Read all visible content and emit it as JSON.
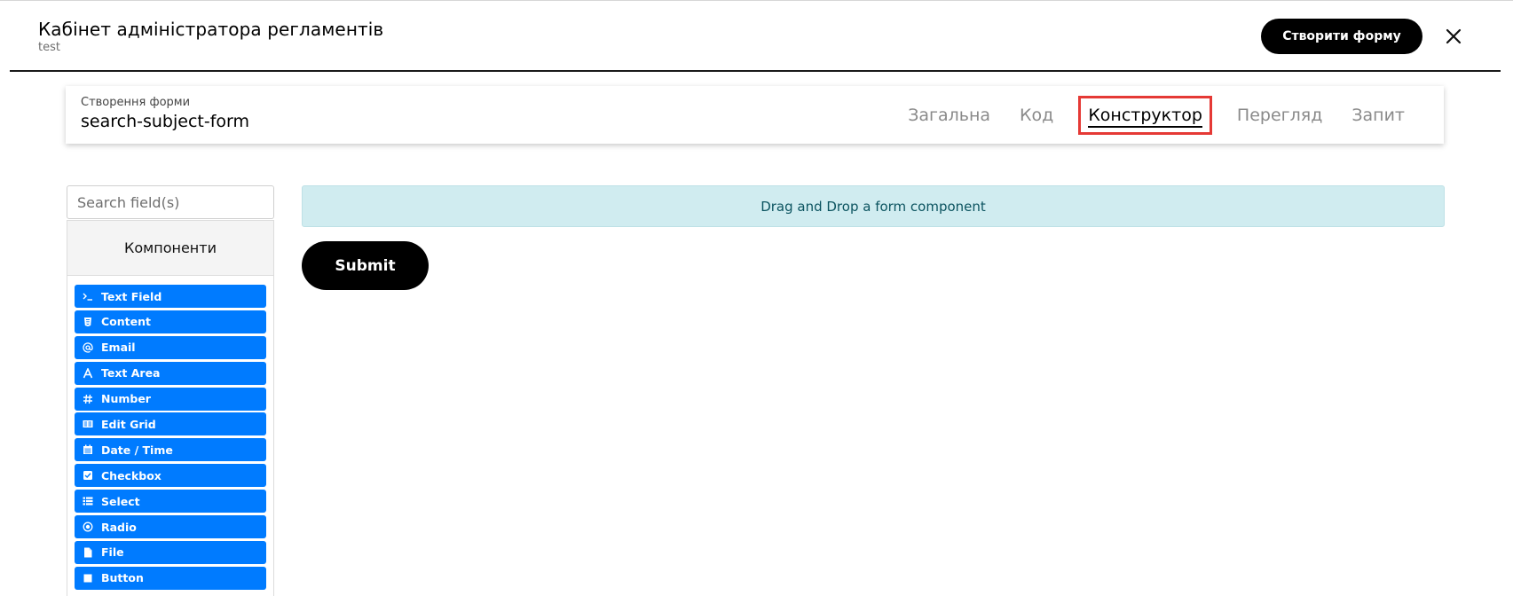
{
  "header": {
    "title": "Кабінет адміністратора регламентів",
    "subtitle": "test",
    "create_button_label": "Створити форму"
  },
  "form_card": {
    "caption": "Створення форми",
    "form_name": "search-subject-form",
    "tabs": [
      {
        "label": "Загальна",
        "active": false
      },
      {
        "label": "Код",
        "active": false
      },
      {
        "label": "Конструктор",
        "active": true
      },
      {
        "label": "Перегляд",
        "active": false
      },
      {
        "label": "Запит",
        "active": false
      }
    ]
  },
  "components_panel": {
    "search_placeholder": "Search field(s)",
    "search_value": "",
    "header": "Компоненти",
    "items": [
      {
        "label": "Text Field",
        "icon": "terminal-icon"
      },
      {
        "label": "Content",
        "icon": "html5-icon"
      },
      {
        "label": "Email",
        "icon": "at-icon"
      },
      {
        "label": "Text Area",
        "icon": "font-icon"
      },
      {
        "label": "Number",
        "icon": "hashtag-icon"
      },
      {
        "label": "Edit Grid",
        "icon": "grid-icon"
      },
      {
        "label": "Date / Time",
        "icon": "calendar-icon"
      },
      {
        "label": "Checkbox",
        "icon": "checkbox-icon"
      },
      {
        "label": "Select",
        "icon": "list-icon"
      },
      {
        "label": "Radio",
        "icon": "radio-icon"
      },
      {
        "label": "File",
        "icon": "file-icon"
      },
      {
        "label": "Button",
        "icon": "stop-icon"
      }
    ]
  },
  "builder": {
    "drop_zone_text": "Drag and Drop a form component",
    "submit_label": "Submit"
  },
  "colors": {
    "component_blue": "#007bff",
    "drop_zone_bg": "#d0ecf0",
    "drop_zone_text": "#0c5460",
    "active_tab_highlight": "#e53935",
    "primary_button": "#000000"
  }
}
